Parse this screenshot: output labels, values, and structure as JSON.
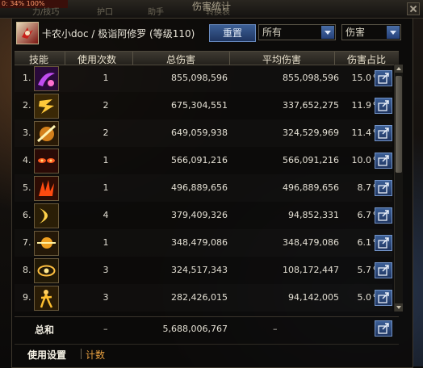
{
  "window": {
    "title": "伤害统计",
    "hp_badge": "0: 34% 100%"
  },
  "background_tabs": [
    "力/技巧",
    "护口",
    "助手",
    "转换表"
  ],
  "header": {
    "character": "卡农小doc / 极诣阿修罗 (等级110)",
    "reset_label": "重置",
    "filter_target": "所有",
    "filter_metric": "伤害"
  },
  "columns": {
    "skill": "技能",
    "uses": "使用次数",
    "total": "总伤害",
    "avg": "平均伤害",
    "pct": "伤害占比"
  },
  "rows": [
    {
      "rank": "1.",
      "uses": "1",
      "total": "855,098,596",
      "avg": "855,098,596",
      "pct": "15.0",
      "pct_sign": "%",
      "icon": "purple-wave-skill-icon"
    },
    {
      "rank": "2.",
      "uses": "2",
      "total": "675,304,551",
      "avg": "337,652,275",
      "pct": "11.9",
      "pct_sign": "%",
      "icon": "yellow-glyph-skill-icon"
    },
    {
      "rank": "3.",
      "uses": "2",
      "total": "649,059,938",
      "avg": "324,529,969",
      "pct": "11.4",
      "pct_sign": "%",
      "icon": "slash-burst-skill-icon"
    },
    {
      "rank": "4.",
      "uses": "1",
      "total": "566,091,216",
      "avg": "566,091,216",
      "pct": "10.0",
      "pct_sign": "%",
      "icon": "red-eyes-skill-icon"
    },
    {
      "rank": "5.",
      "uses": "1",
      "total": "496,889,656",
      "avg": "496,889,656",
      "pct": "8.7",
      "pct_sign": "%",
      "icon": "fire-claw-skill-icon"
    },
    {
      "rank": "6.",
      "uses": "4",
      "total": "379,409,326",
      "avg": "94,852,331",
      "pct": "6.7",
      "pct_sign": "%",
      "icon": "crescent-skill-icon"
    },
    {
      "rank": "7.",
      "uses": "1",
      "total": "348,479,086",
      "avg": "348,479,086",
      "pct": "6.1",
      "pct_sign": "%",
      "icon": "golden-strike-skill-icon"
    },
    {
      "rank": "8.",
      "uses": "3",
      "total": "324,517,343",
      "avg": "108,172,447",
      "pct": "5.7",
      "pct_sign": "%",
      "icon": "eye-ring-skill-icon"
    },
    {
      "rank": "9.",
      "uses": "3",
      "total": "282,426,015",
      "avg": "94,142,005",
      "pct": "5.0",
      "pct_sign": "%",
      "icon": "warrior-figure-skill-icon"
    }
  ],
  "total": {
    "label": "总和",
    "uses": "–",
    "total": "5,688,006,767",
    "avg": "–"
  },
  "bottom_tabs": {
    "settings": "使用设置",
    "counter": "计数"
  },
  "colors": {
    "accent_blue": "#3c5f96",
    "counter_tab": "#e8a040"
  }
}
